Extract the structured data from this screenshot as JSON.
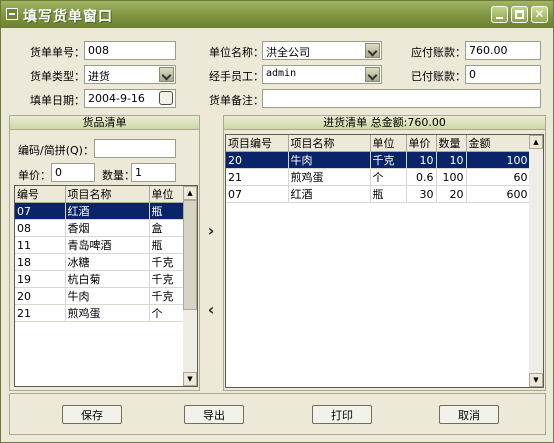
{
  "window": {
    "title": "填写货单窗口"
  },
  "form": {
    "order_no_label": "货单单号：",
    "order_no": "008",
    "unit_label": "单位名称：",
    "unit": "洪全公司",
    "payable_label": "应付账款：",
    "payable": "760.00",
    "type_label": "货单类型：",
    "type": "进货",
    "handler_label": "经手员工：",
    "handler": "admin",
    "paid_label": "已付账款：",
    "paid": "0",
    "date_label": "填单日期：",
    "date": "2004-9-16",
    "remark_label": "货单备注：",
    "remark": ""
  },
  "goods": {
    "title": "货品清单",
    "code_label": "编码/简拼(Q)：",
    "code": "",
    "price_label": "单价：",
    "price": "0",
    "qty_label": "数量：",
    "qty": "1",
    "columns": [
      "编号",
      "项目名称",
      "单位"
    ],
    "rows": [
      [
        "07",
        "红酒",
        "瓶"
      ],
      [
        "08",
        "香烟",
        "盒"
      ],
      [
        "11",
        "青岛啤酒",
        "瓶"
      ],
      [
        "18",
        "冰糖",
        "千克"
      ],
      [
        "19",
        "杭白菊",
        "千克"
      ],
      [
        "20",
        "牛肉",
        "千克"
      ],
      [
        "21",
        "煎鸡蛋",
        "个"
      ]
    ]
  },
  "purchase": {
    "title": "进货清单 总金额:760.00",
    "columns": [
      "项目编号",
      "项目名称",
      "单位",
      "单价",
      "数量",
      "金额"
    ],
    "rows": [
      [
        "20",
        "牛肉",
        "千克",
        "10",
        "10",
        "100"
      ],
      [
        "21",
        "煎鸡蛋",
        "个",
        "0.6",
        "100",
        "60"
      ],
      [
        "07",
        "红酒",
        "瓶",
        "30",
        "20",
        "600"
      ]
    ]
  },
  "actions": {
    "save": "保存",
    "export": "导出",
    "print": "打印",
    "cancel": "取消"
  }
}
